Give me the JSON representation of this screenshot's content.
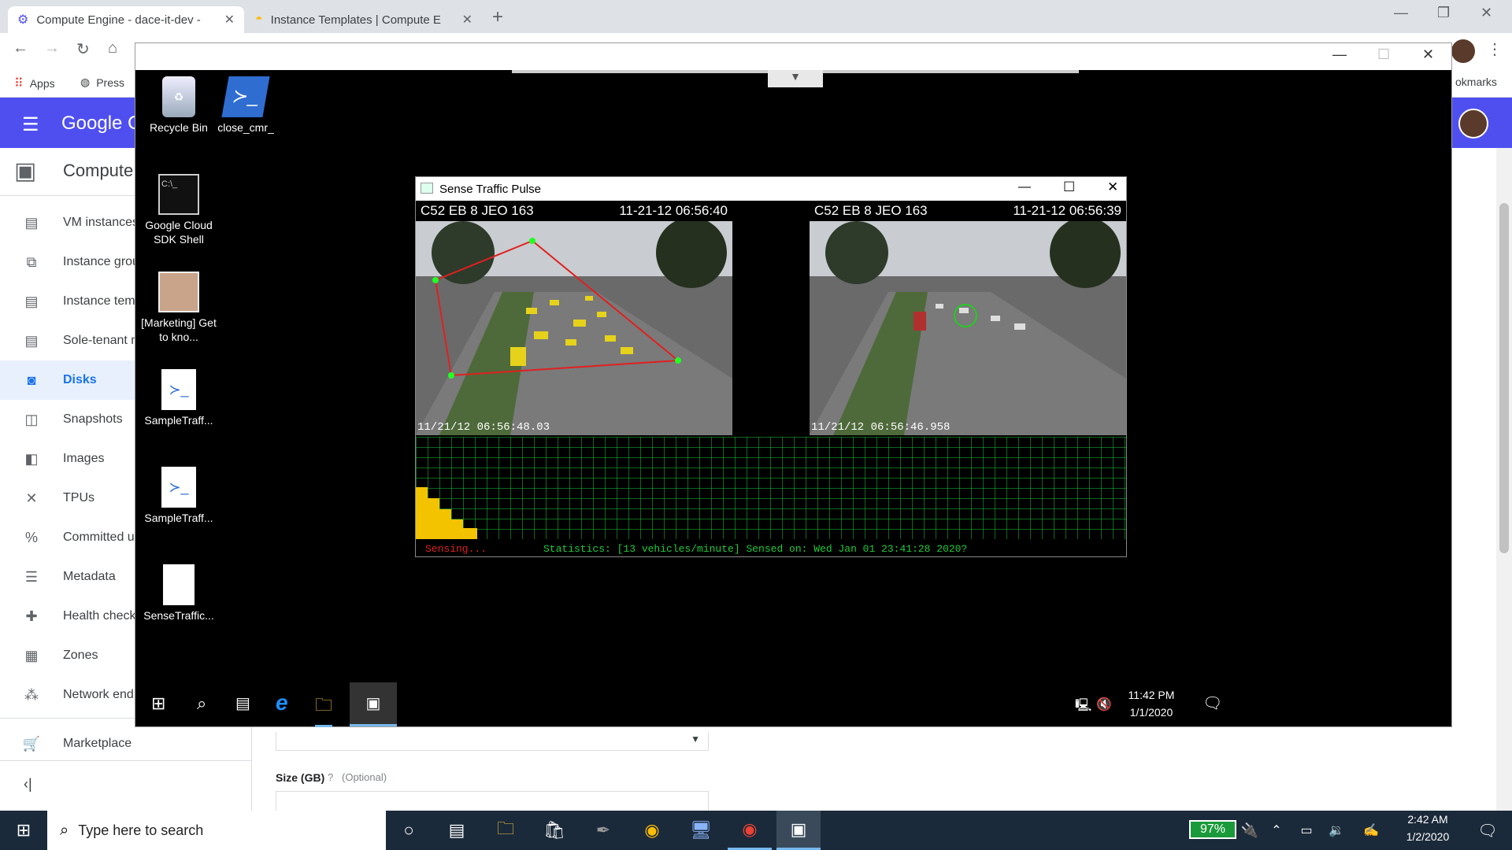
{
  "browser": {
    "tabs": [
      {
        "title": "Compute Engine - dace-it-dev - \u0007",
        "active": true
      },
      {
        "title": "Instance Templates | Compute E",
        "active": false
      }
    ],
    "bookmarks": {
      "apps": "Apps",
      "press": "Press",
      "other": "okmarks"
    }
  },
  "gcp": {
    "brand": "Google C",
    "product": "Compute",
    "nav": [
      {
        "label": "VM instances",
        "icon": "vm-icon"
      },
      {
        "label": "Instance groups",
        "icon": "instance-groups-icon"
      },
      {
        "label": "Instance templates",
        "icon": "template-icon"
      },
      {
        "label": "Sole-tenant nodes",
        "icon": "sole-tenant-icon"
      },
      {
        "label": "Disks",
        "icon": "disk-icon",
        "active": true
      },
      {
        "label": "Snapshots",
        "icon": "snapshot-icon"
      },
      {
        "label": "Images",
        "icon": "images-icon"
      },
      {
        "label": "TPUs",
        "icon": "tpu-icon"
      },
      {
        "label": "Committed use discounts",
        "icon": "percent-icon"
      },
      {
        "label": "Metadata",
        "icon": "metadata-icon"
      },
      {
        "label": "Health checks",
        "icon": "health-icon"
      },
      {
        "label": "Zones",
        "icon": "zones-icon"
      },
      {
        "label": "Network endpoint groups",
        "icon": "network-icon"
      }
    ],
    "marketplace": "Marketplace",
    "size_label": "Size (GB)",
    "size_optional": "(Optional)"
  },
  "rdp": {
    "desktop_icons": [
      {
        "label": "Recycle Bin"
      },
      {
        "label": "close_cmr_"
      },
      {
        "label": "Google Cloud SDK Shell"
      },
      {
        "label": "[Marketing] Get to kno..."
      },
      {
        "label": "SampleTraff..."
      },
      {
        "label": "SampleTraff..."
      },
      {
        "label": "SenseTraffic..."
      }
    ],
    "app": {
      "title": "Sense Traffic Pulse",
      "cam_left_head": "C52 EB 8 JEO 163",
      "cam_left_time": "11-21-12 06:56:40",
      "cam_left_stamp": "11/21/12 06:56:48.03",
      "cam_right_head": "C52 EB 8 JEO 163",
      "cam_right_time": "11-21-12 06:56:39",
      "cam_right_stamp": "11/21/12 06:56:46.958",
      "sensing": "Sensing...",
      "stats": "Statistics: [13 vehicles/minute] Sensed on: Wed Jan 01 23:41:28 2020?"
    },
    "clock_time": "11:42 PM",
    "clock_date": "1/1/2020"
  },
  "taskbar": {
    "search_placeholder": "Type here to search",
    "battery": "97%",
    "time": "2:42 AM",
    "date": "1/2/2020"
  }
}
